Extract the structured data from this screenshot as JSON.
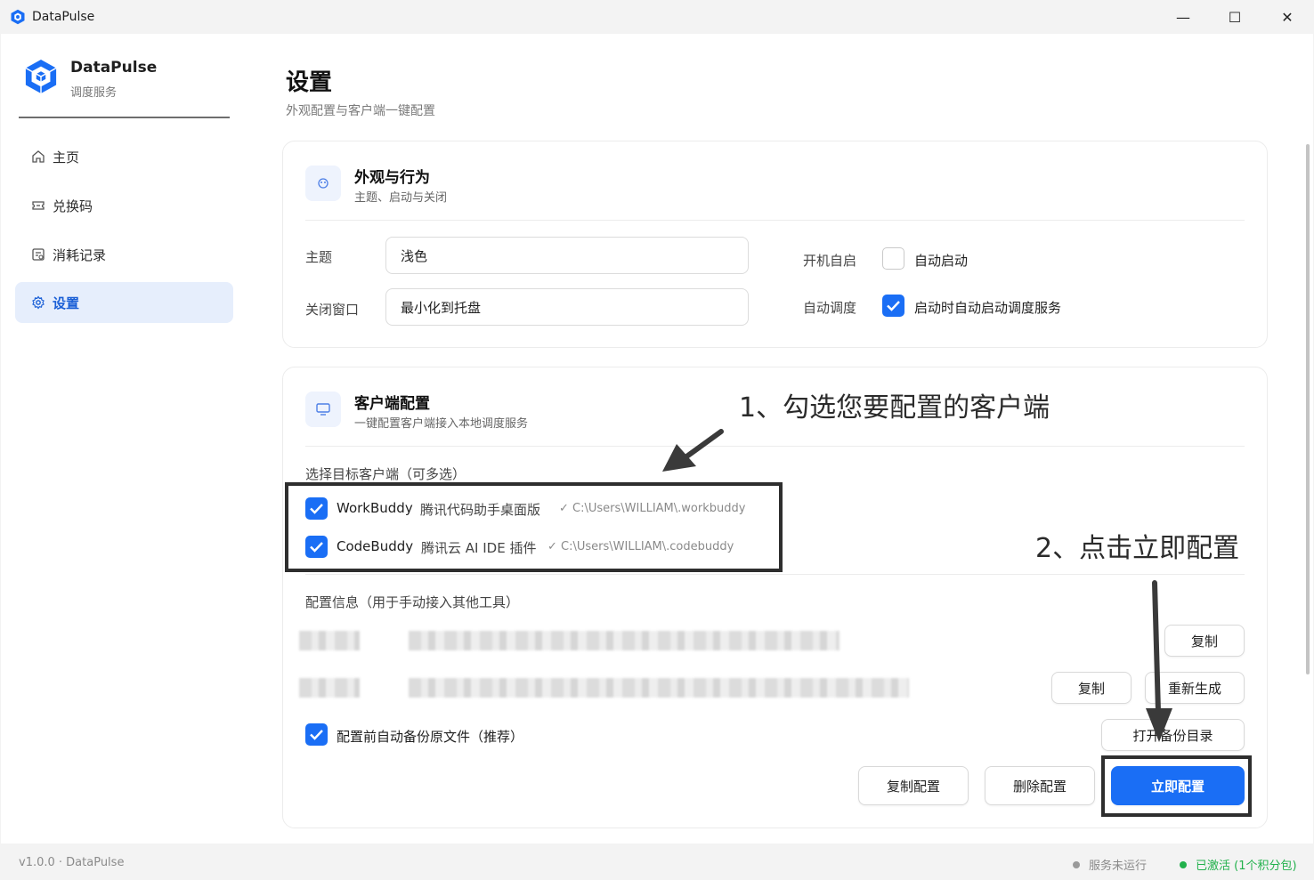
{
  "window": {
    "title": "DataPulse",
    "controls": {
      "minimize": "—",
      "maximize": "☐",
      "close": "✕"
    }
  },
  "sidebar": {
    "brand_name": "DataPulse",
    "brand_sub": "调度服务",
    "items": [
      {
        "label": "主页",
        "icon": "home-icon"
      },
      {
        "label": "兑换码",
        "icon": "ticket-icon"
      },
      {
        "label": "消耗记录",
        "icon": "records-icon"
      },
      {
        "label": "设置",
        "icon": "gear-icon",
        "active": true
      }
    ]
  },
  "page": {
    "title": "设置",
    "subtitle": "外观配置与客户端一键配置"
  },
  "appearance": {
    "title": "外观与行为",
    "subtitle": "主题、启动与关闭",
    "theme_label": "主题",
    "theme_value": "浅色",
    "close_label": "关闭窗口",
    "close_value": "最小化到托盘",
    "startup_label": "开机自启",
    "startup_checkbox": "自动启动",
    "startup_checked": false,
    "schedule_label": "自动调度",
    "schedule_checkbox": "启动时自动启动调度服务",
    "schedule_checked": true
  },
  "client": {
    "title": "客户端配置",
    "subtitle": "一键配置客户端接入本地调度服务",
    "select_label": "选择目标客户端（可多选）",
    "clients": [
      {
        "name": "WorkBuddy",
        "desc": "腾讯代码助手桌面版",
        "path": "✓ C:\\Users\\WILLIAM\\.workbuddy",
        "checked": true
      },
      {
        "name": "CodeBuddy",
        "desc": "腾讯云 AI IDE 插件",
        "path": "✓ C:\\Users\\WILLIAM\\.codebuddy",
        "checked": true
      }
    ],
    "config_info_label": "配置信息（用于手动接入其他工具）",
    "copy_button": "复制",
    "copy_button_2": "复制",
    "regenerate_button": "重新生成",
    "backup_checkbox": "配置前自动备份原文件（推荐）",
    "backup_checked": true,
    "open_backup_button": "打开备份目录",
    "copy_config_button": "复制配置",
    "delete_config_button": "删除配置",
    "apply_button": "立即配置"
  },
  "annotations": {
    "step1": "1、勾选您要配置的客户端",
    "step2": "2、点击立即配置"
  },
  "footer": {
    "version": "v1.0.0 · DataPulse",
    "service_status": "服务未运行",
    "activation_status": "已激活 (1个积分包)",
    "colors": {
      "inactive": "#9a9a9a",
      "active": "#22b14c"
    }
  },
  "colors": {
    "accent": "#1a6ef5",
    "active_nav_bg": "#e6eefc"
  }
}
